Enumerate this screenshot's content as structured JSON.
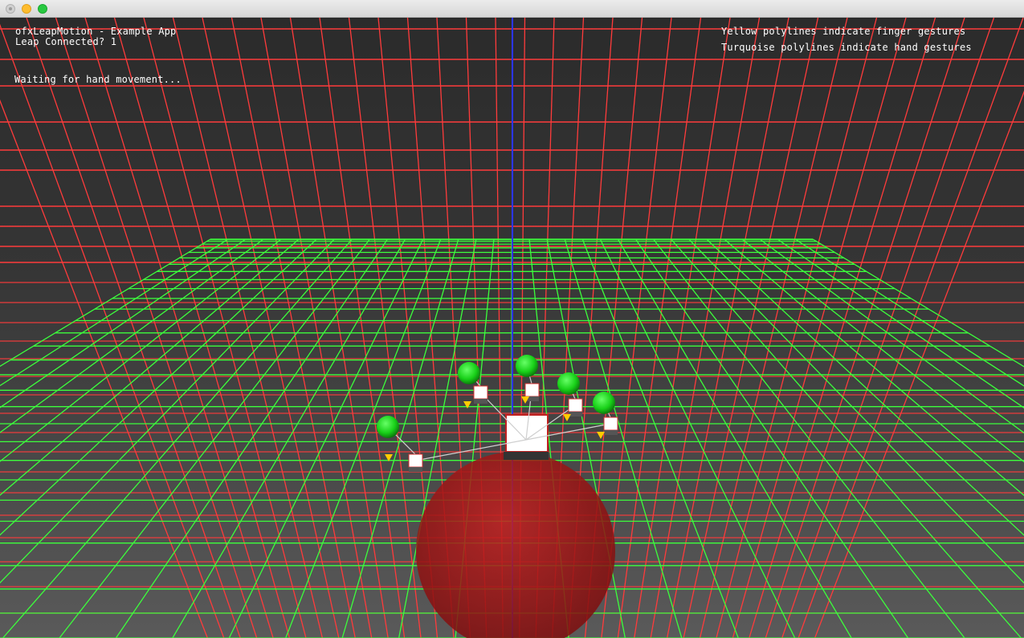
{
  "window": {
    "title": ""
  },
  "hud": {
    "app_name": "ofxLeapMotion - Example App",
    "connection_status": "Leap Connected? 1",
    "status_message": "Waiting for hand movement...",
    "legend_finger": "Yellow polylines indicate finger gestures",
    "legend_hand": "Turquoise polylines indicate hand gestures"
  },
  "scene": {
    "colors": {
      "wall_grid": "#ff3b3b",
      "floor_grid": "#3cff3c",
      "y_axis": "#2b35ff",
      "fingertip": "#22ee22",
      "palm_sphere": "#b01a1a",
      "joint_box": "#ffffff",
      "gesture_marker": "#ffcc00"
    },
    "finger_count": 5
  }
}
